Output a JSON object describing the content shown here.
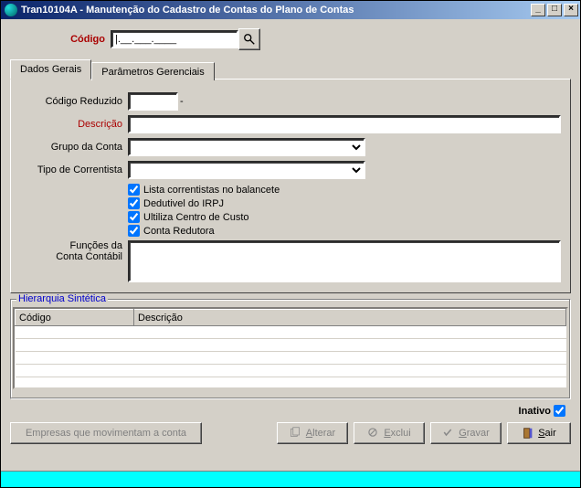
{
  "window": {
    "title": "Tran10104A - Manutenção do Cadastro de Contas do Plano de Contas"
  },
  "header": {
    "codigo_label": "Código",
    "codigo_value": "|.__.___.____"
  },
  "tabs": {
    "dados_gerais": "Dados Gerais",
    "parametros_gerenciais": "Parâmetros Gerenciais"
  },
  "form": {
    "codigo_reduzido_label": "Código Reduzido",
    "codigo_reduzido_value": "",
    "descricao_label": "Descrição",
    "descricao_value": "",
    "grupo_conta_label": "Grupo da Conta",
    "grupo_conta_value": "",
    "tipo_correntista_label": "Tipo de Correntista",
    "tipo_correntista_value": "",
    "chk_lista_correntistas": "Lista correntistas no balancete",
    "chk_dedutivel_irpj": "Dedutivel do IRPJ",
    "chk_utiliza_centro_custo": "Ultiliza Centro de Custo",
    "chk_conta_redutora": "Conta Redutora",
    "funcoes_label": "Funções da\nConta Contábil",
    "funcoes_value": ""
  },
  "hierarquia": {
    "title": "Hierarquia Sintética",
    "col_codigo": "Código",
    "col_descricao": "Descrição"
  },
  "status": {
    "inativo_label": "Inativo"
  },
  "buttons": {
    "empresas": "Empresas que movimentam a conta",
    "alterar": "Alterar",
    "excluir": "Exclui",
    "gravar": "Gravar",
    "sair": "Sair"
  }
}
